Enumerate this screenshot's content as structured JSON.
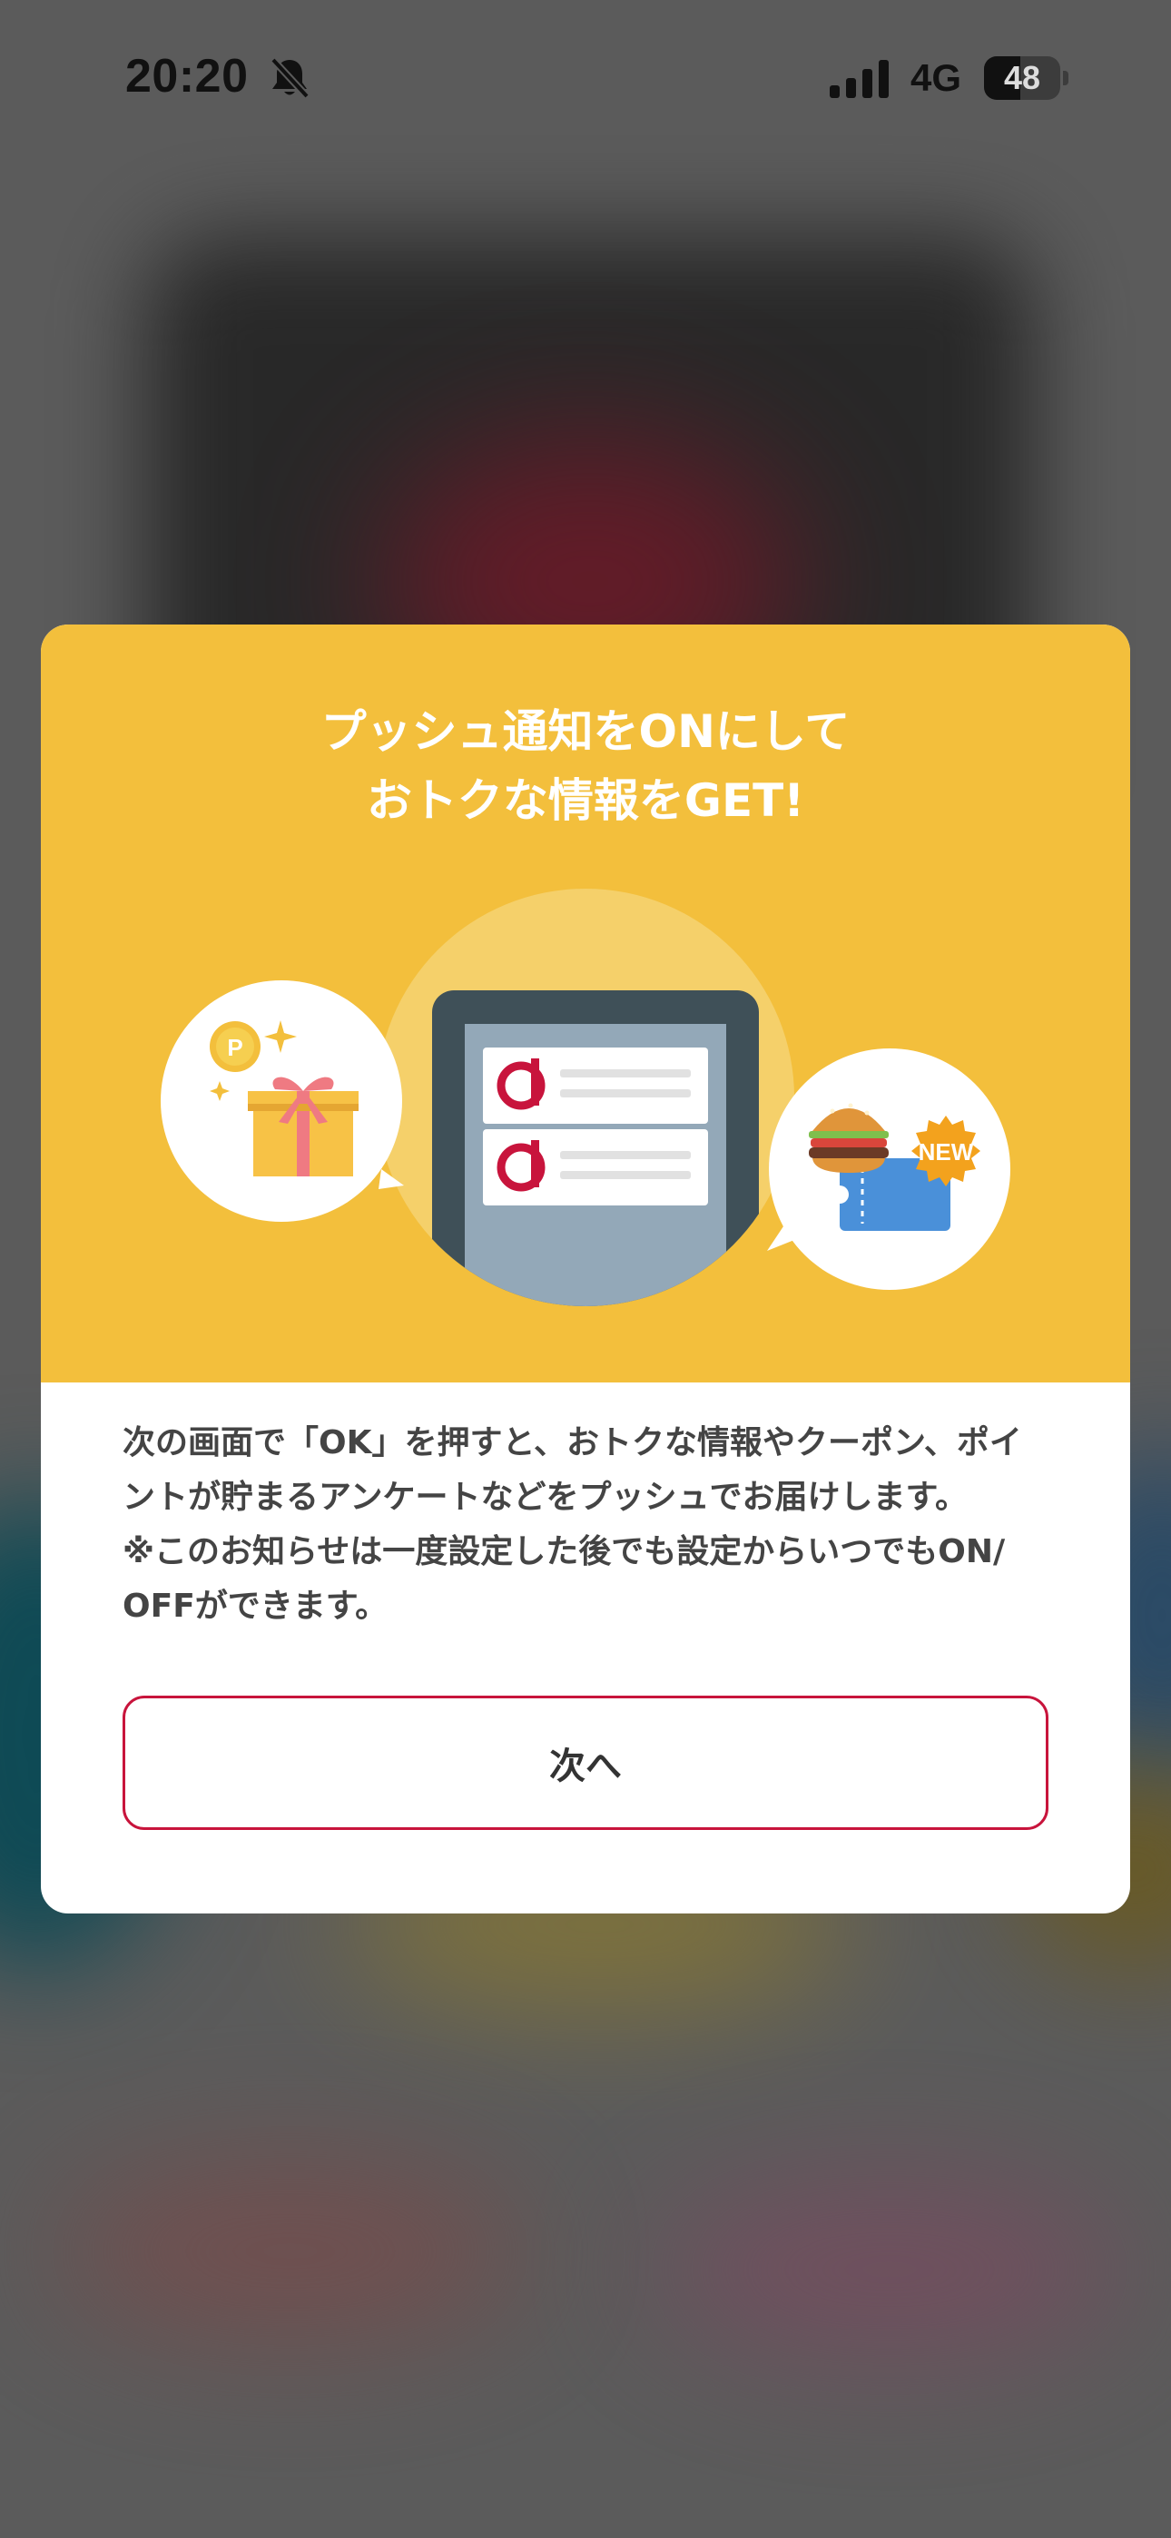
{
  "status_bar": {
    "time": "20:20",
    "network": "4G",
    "battery_level": "48",
    "battery_fraction": 0.48,
    "icons": [
      "bell-slash-icon",
      "cellular-signal-icon",
      "battery-icon"
    ]
  },
  "modal": {
    "title_line1": "プッシュ通知をONにして",
    "title_line2": "おトクな情報をGET!",
    "header_color": "#f3bf3c",
    "illustration": {
      "coin_label": "P",
      "badge_label": "NEW",
      "icons": [
        "gift-icon",
        "point-coin-icon",
        "sparkle-icon",
        "phone-notifications-icon",
        "d-logo-icon",
        "hamburger-icon",
        "coupon-ticket-icon",
        "new-badge-icon"
      ]
    },
    "body_lines": [
      "次の画面で「OK」を押すと、おトクな情報やクーポン、ポイ",
      "ントが貯まるアンケートなどをプッシュでお届けします。",
      "※このお知らせは一度設定した後でも設定からいつでもON/",
      "OFFができます。"
    ],
    "next_button_label": "次へ",
    "accent_color": "#c8143c"
  }
}
